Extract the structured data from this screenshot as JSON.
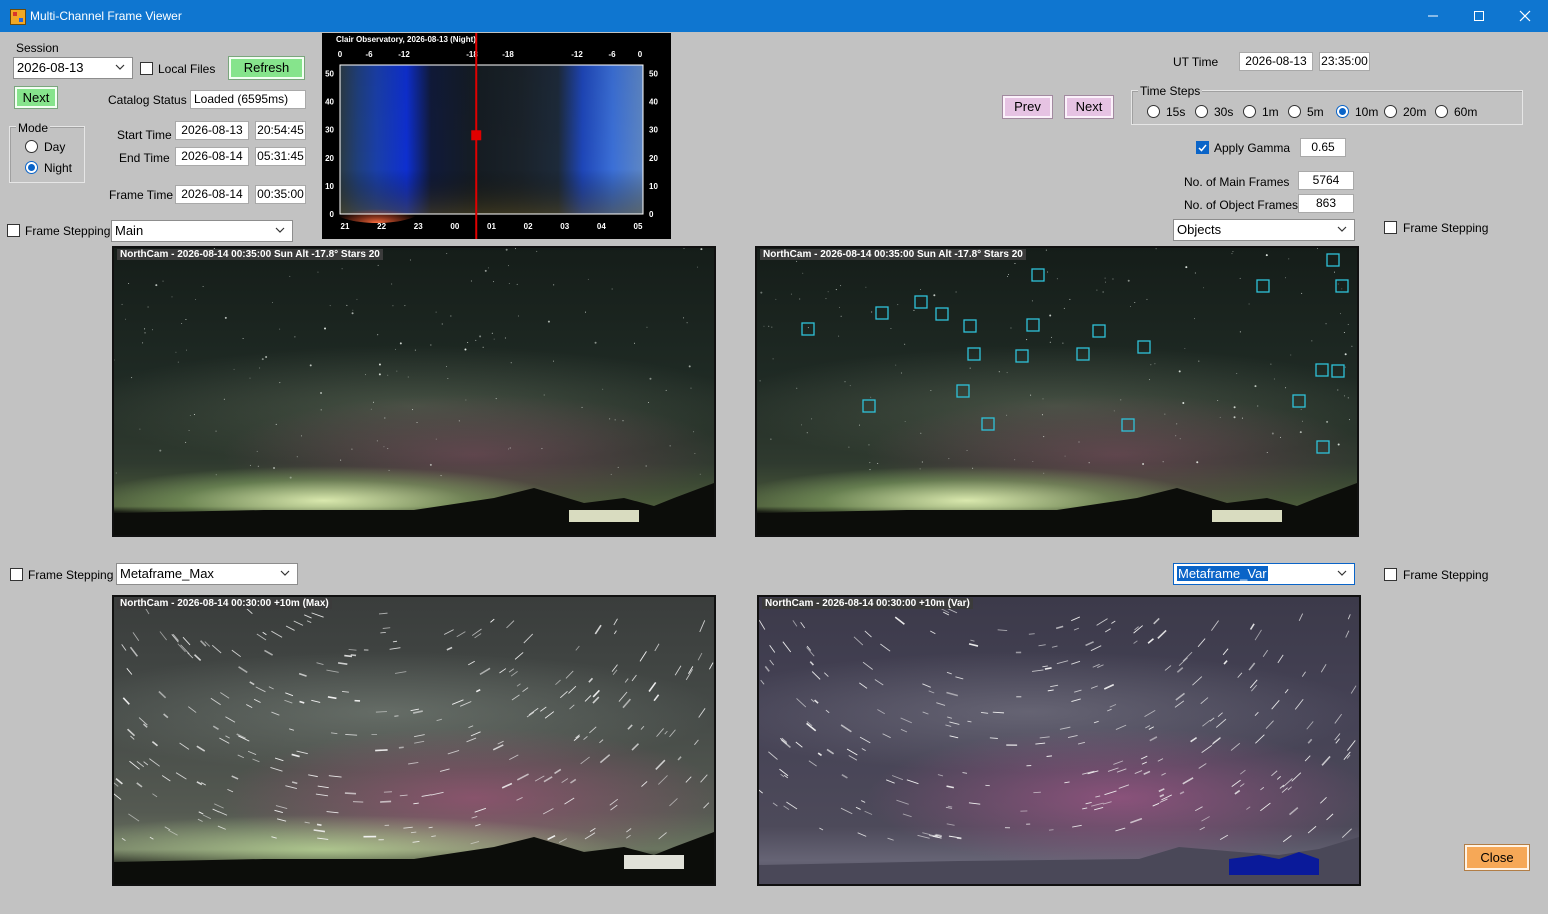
{
  "window": {
    "title": "Multi-Channel Frame Viewer"
  },
  "session": {
    "label": "Session",
    "date": "2026-08-13",
    "local_files_label": "Local Files",
    "refresh_label": "Refresh",
    "next_label": "Next",
    "catalog_status_label": "Catalog Status",
    "catalog_status_value": "Loaded (6595ms)"
  },
  "mode": {
    "label": "Mode",
    "options": [
      "Day",
      "Night"
    ],
    "selected": "Night"
  },
  "times": {
    "start_label": "Start Time",
    "start_date": "2026-08-13",
    "start_time": "20:54:45",
    "end_label": "End Time",
    "end_date": "2026-08-14",
    "end_time": "05:31:45",
    "frame_label": "Frame Time",
    "frame_date": "2026-08-14",
    "frame_time": "00:35:00"
  },
  "chart_data": {
    "type": "heatmap",
    "title": "Clair Observatory, 2026-08-13 (Night)",
    "x_tick_labels": [
      "21",
      "22",
      "23",
      "00",
      "01",
      "02",
      "03",
      "04",
      "05"
    ],
    "top_tick_labels": [
      "0",
      "-6",
      "-12",
      "-18",
      "-18",
      "-12",
      "-6",
      "0"
    ],
    "y_tick_labels": [
      "0",
      "10",
      "20",
      "30",
      "40",
      "50"
    ],
    "ylim": [
      0,
      53
    ],
    "cursor": {
      "x": "00:35",
      "y": 28
    },
    "cursor_color": "#e00000"
  },
  "ut": {
    "label": "UT Time",
    "date": "2026-08-13",
    "time": "23:35:00"
  },
  "nav": {
    "prev_label": "Prev",
    "next_label": "Next"
  },
  "time_steps": {
    "label": "Time Steps",
    "options": [
      "15s",
      "30s",
      "1m",
      "5m",
      "10m",
      "20m",
      "60m"
    ],
    "selected": "10m"
  },
  "gamma": {
    "label": "Apply Gamma",
    "value": "0.65",
    "checked": true
  },
  "counts": {
    "main_label": "No. of Main Frames",
    "main_value": "5764",
    "object_label": "No. of Object Frames",
    "object_value": "863"
  },
  "panels": {
    "top_left": {
      "stepping_label": "Frame Stepping",
      "channel": "Main",
      "caption": "NorthCam - 2026-08-14 00:35:00  Sun Alt -17.8° Stars 20"
    },
    "top_right": {
      "stepping_label": "Frame Stepping",
      "channel": "Objects",
      "caption": "NorthCam - 2026-08-14 00:35:00  Sun Alt -17.8° Stars 20"
    },
    "bottom_left": {
      "stepping_label": "Frame Stepping",
      "channel": "Metaframe_Max",
      "caption": "NorthCam - 2026-08-14 00:30:00 +10m  (Max)"
    },
    "bottom_right": {
      "stepping_label": "Frame Stepping",
      "channel": "Metaframe_Var",
      "caption": "NorthCam - 2026-08-14 00:30:00 +10m  (Var)"
    }
  },
  "close_label": "Close",
  "colors": {
    "titlebar": "#0f76d0",
    "green_button": "#86e48c",
    "purple_button": "#e6c3e3",
    "orange_button": "#f6a857",
    "object_box": "#2fc2d9"
  }
}
